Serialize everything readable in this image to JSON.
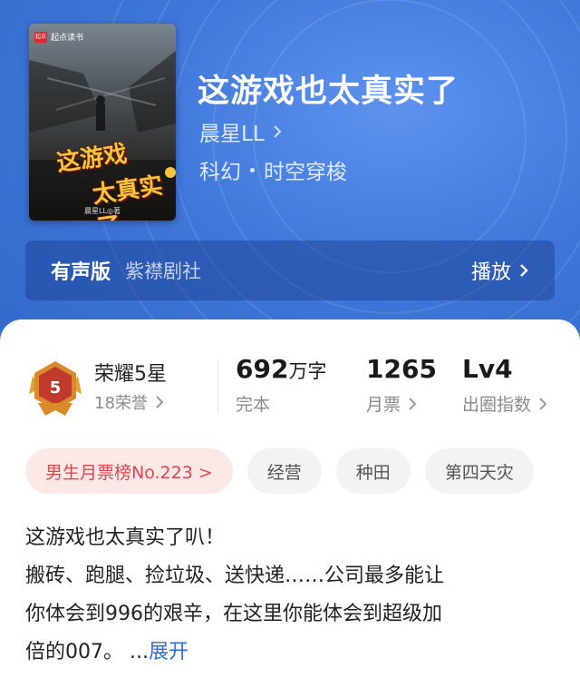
{
  "book": {
    "title": "这游戏也太真实了",
    "author": "晨星LL",
    "genre": "科幻",
    "subgenre": "时空穿梭"
  },
  "cover": {
    "badge_text": "起点读书",
    "badge_icon_text": "起点",
    "title_line1": "这游戏",
    "title_line2": "太真实了",
    "author_text": "晨星LL◎著"
  },
  "audio": {
    "label": "有声版",
    "studio": "紫襟剧社",
    "play_label": "播放"
  },
  "honor": {
    "medal_number": "5",
    "title": "荣耀5星",
    "sub": "18荣誉"
  },
  "stats": [
    {
      "value": "692",
      "unit": "万字",
      "label": "完本"
    },
    {
      "value": "1265",
      "unit": "",
      "label": "月票"
    },
    {
      "value": "Lv4",
      "unit": "",
      "label": "出圈指数"
    }
  ],
  "tags": [
    {
      "label": "男生月票榜No.223 >"
    },
    {
      "label": "经营"
    },
    {
      "label": "种田"
    },
    {
      "label": "第四天灾"
    }
  ],
  "description": {
    "lines": [
      "这游戏也太真实了叭！",
      "搬砖、跑腿、捡垃圾、送快递……公司最多能让",
      "你体会到996的艰辛，在这里你能体会到超级加",
      "倍的007。 ..."
    ],
    "more_label": "展开"
  },
  "colors": {
    "hero_bg": "#3f77da",
    "rank_tag_text": "#e1464b",
    "link_blue": "#2b6ee6",
    "cover_title": "#f4c53b"
  }
}
